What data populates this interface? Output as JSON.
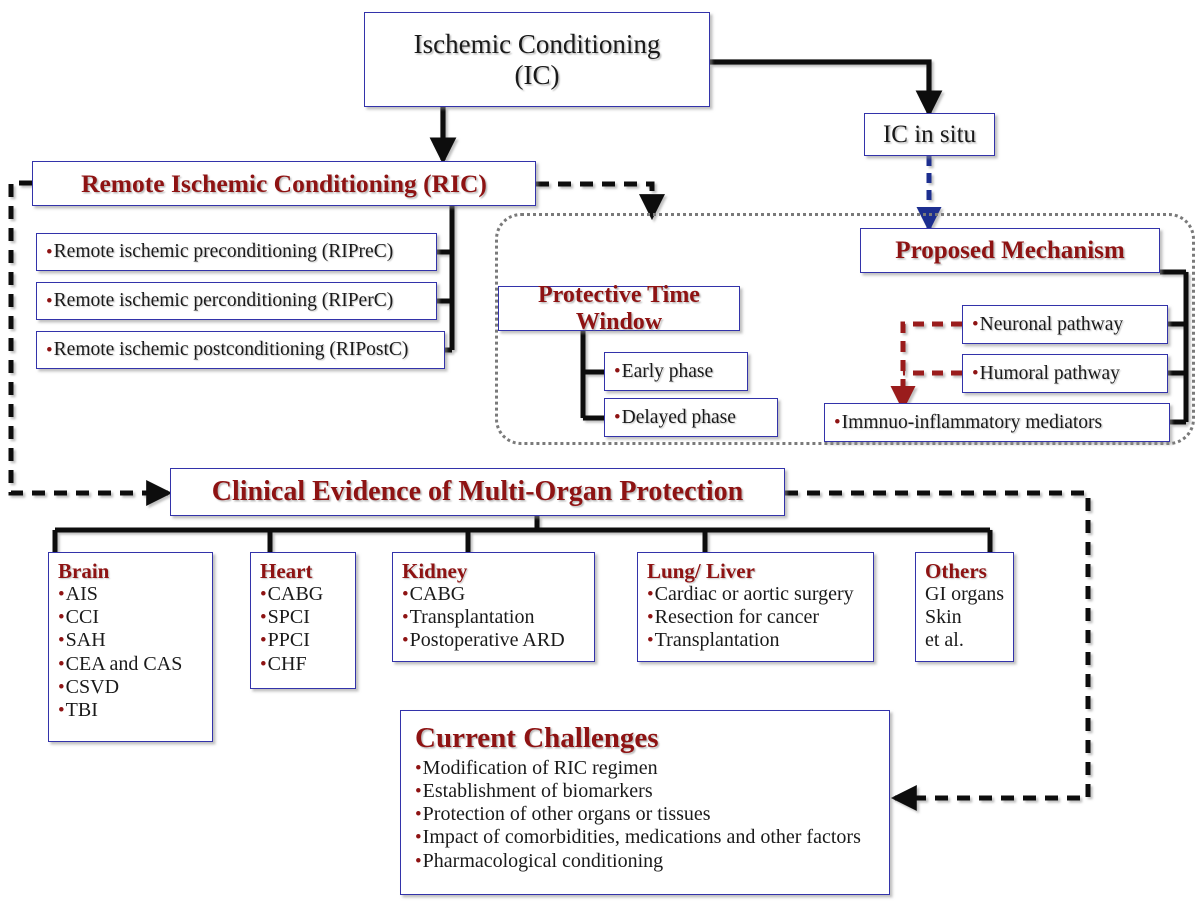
{
  "diagram": {
    "title": "Ischemic Conditioning flowchart",
    "colors": {
      "heading_red": "#8e1313",
      "box_border_blue": "#3333aa",
      "connector_black": "#111111",
      "dotted_region_gray": "#7a7a7a",
      "red_dashed_arrow": "#9a1b1b",
      "blue_dashed_arrow": "#1f2f8f"
    }
  },
  "nodes": {
    "ischemic_conditioning": {
      "line1": "Ischemic Conditioning",
      "line2": "(IC)"
    },
    "ic_in_situ": {
      "label": "IC in situ"
    },
    "ric": {
      "label": "Remote Ischemic Conditioning (RIC)"
    },
    "ric_items": [
      {
        "label": "Remote ischemic preconditioning (RIPreC)"
      },
      {
        "label": "Remote ischemic perconditioning (RIPerC)"
      },
      {
        "label": "Remote ischemic postconditioning (RIPostC)"
      }
    ],
    "protective_time_window": {
      "label": "Protective Time Window"
    },
    "ptw_items": [
      {
        "label": "Early phase"
      },
      {
        "label": "Delayed phase"
      }
    ],
    "proposed_mechanism": {
      "label": "Proposed Mechanism"
    },
    "mechanism_items": [
      {
        "label": "Neuronal pathway"
      },
      {
        "label": "Humoral pathway"
      },
      {
        "label": "Immnuo-inflammatory mediators"
      }
    ],
    "clinical_evidence": {
      "label": "Clinical Evidence of Multi-Organ Protection"
    },
    "organs": [
      {
        "heading": "Brain",
        "bulleted": true,
        "items": [
          "AIS",
          "CCI",
          "SAH",
          "CEA and CAS",
          "CSVD",
          "TBI"
        ]
      },
      {
        "heading": "Heart",
        "bulleted": true,
        "items": [
          "CABG",
          "SPCI",
          "PPCI",
          "CHF"
        ]
      },
      {
        "heading": "Kidney",
        "bulleted": true,
        "items": [
          "CABG",
          "Transplantation",
          "Postoperative ARD"
        ]
      },
      {
        "heading": "Lung/ Liver",
        "bulleted": true,
        "items": [
          "Cardiac or aortic surgery",
          "Resection for cancer",
          "Transplantation"
        ]
      },
      {
        "heading": "Others",
        "bulleted": false,
        "items": [
          "GI organs",
          "Skin",
          "et al."
        ]
      }
    ],
    "current_challenges": {
      "heading": "Current Challenges",
      "items": [
        "Modification of RIC regimen",
        "Establishment of biomarkers",
        "Protection of other organs or tissues",
        "Impact of comorbidities, medications and other factors",
        "Pharmacological conditioning"
      ]
    }
  }
}
